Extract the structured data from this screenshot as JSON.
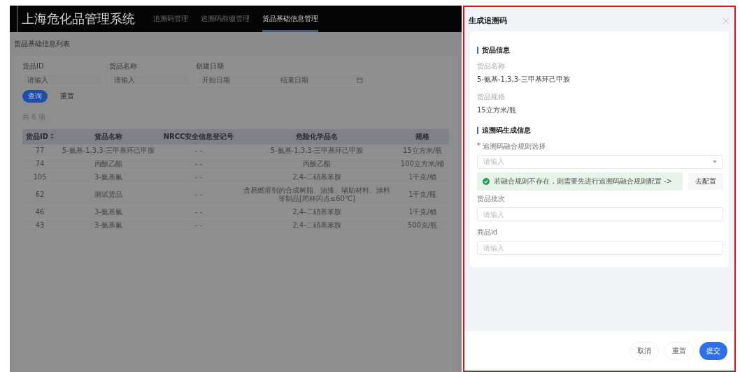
{
  "app": {
    "title": "上海危化品管理系统",
    "tabs": [
      {
        "label": "追溯码管理",
        "selected": false
      },
      {
        "label": "追溯码前缀管理",
        "selected": false
      },
      {
        "label": "货品基础信息管理",
        "selected": true
      }
    ]
  },
  "list": {
    "title": "货品基础信息列表",
    "filters": [
      {
        "kind": "text",
        "label": "货品ID",
        "placeholder": "请输入"
      },
      {
        "kind": "text",
        "label": "货品名称",
        "placeholder": "请输入"
      },
      {
        "kind": "daterange",
        "label": "创建日期",
        "placeholder": "开始日期",
        "placeholder_end": "结束日期"
      }
    ],
    "buttons": [
      {
        "label": "查询",
        "primary": true
      },
      {
        "label": "重置",
        "primary": false
      }
    ],
    "total": "共 6 项",
    "table": {
      "columns": [
        "货品ID",
        "货品名称",
        "NRCC安全信息登记号",
        "危险化学品名",
        "规格"
      ],
      "rows": [
        [
          "77",
          "5-氨基-1,3,3-三甲基环己甲胺",
          "- -",
          "5-氨基-1,3,3-三甲基环己甲胺",
          "15立方米/瓶"
        ],
        [
          "74",
          "丙酸乙酯",
          "- -",
          "丙酸乙酯",
          "100立方米/桶"
        ],
        [
          "105",
          "3-氨基氟",
          "- -",
          "2,4-二硝基苯胺",
          "1千克/桶"
        ],
        [
          "62",
          "测试货品",
          "- -",
          "含易燃溶剂的合成树脂、油漆、辅助材料、涂料等制品[闭杯闪点≤60℃]",
          "1千克/瓶"
        ],
        [
          "46",
          "3-氨基氟",
          "- -",
          "2,4-二硝基苯胺",
          "1千克/桶"
        ],
        [
          "43",
          "3-氨基氟",
          "- -",
          "2,4-二硝基苯胺",
          "500克/瓶"
        ]
      ]
    }
  },
  "drawer": {
    "title": "生成追溯码",
    "info_title": "货品信息",
    "info": [
      {
        "label": "货品名称",
        "value": "5-氨基-1,3,3-三甲基环己甲胺"
      },
      {
        "label": "货品规格",
        "value": "15立方米/瓶"
      }
    ],
    "form_title": "追溯码生成信息",
    "rule": {
      "required_mark": "*",
      "label": "追溯码融合规则选择",
      "placeholder": "请输入"
    },
    "alert": {
      "text": "若融合规则不存在，则需要先进行追溯码融合规则配置 ->",
      "button": "去配置"
    },
    "fields": [
      {
        "label": "货品批次",
        "placeholder": "请输入"
      },
      {
        "label": "商品id",
        "placeholder": "请输入"
      }
    ],
    "footer": [
      {
        "label": "取消",
        "primary": false
      },
      {
        "label": "重置",
        "primary": false
      },
      {
        "label": "提交",
        "primary": true
      }
    ]
  }
}
